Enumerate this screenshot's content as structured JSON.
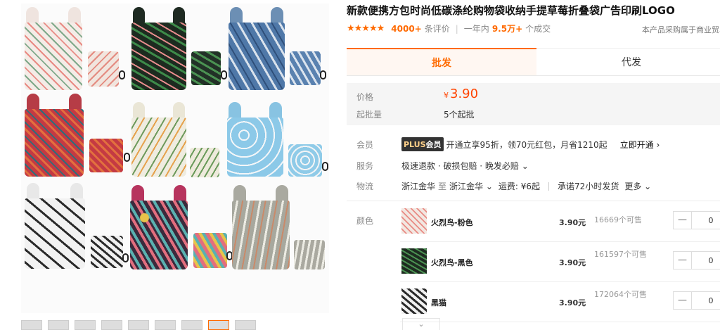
{
  "product": {
    "title": "新款便携方包时尚低碳涤纶购物袋收纳手提草莓折叠袋广告印刷LOGO",
    "stars": "★★★★★",
    "reviews_count": "4000+",
    "reviews_label": "条评价",
    "sales_period": "一年内",
    "sales_count": "9.5万+",
    "sales_label": "个成交",
    "purchase_note": "本产品采购属于商业贸易"
  },
  "tabs": [
    {
      "label": "批发",
      "active": true
    },
    {
      "label": "代发",
      "active": false
    }
  ],
  "price": {
    "label": "价格",
    "currency": "¥",
    "value": "3.90",
    "moq_label": "起批量",
    "moq_value": "5个起批"
  },
  "member": {
    "label": "会员",
    "badge_plus": "PLUS",
    "badge_text": "会员",
    "benefit": "开通立享95折，领70元红包，月省1210起",
    "cta": "立即开通 ›"
  },
  "service": {
    "label": "服务",
    "items": "极速退款 · 破损包赔 · 晚发必赔 ⌄"
  },
  "logistics": {
    "label": "物流",
    "from": "浙江金华",
    "to_label": "至",
    "to": "浙江金华 ⌄",
    "fee": "运费: ¥6起",
    "promise": "承诺72小时发货",
    "more": "更多 ⌄"
  },
  "colors": {
    "label": "颜色",
    "items": [
      {
        "name": "火烈鸟-粉色",
        "price": "3.90元",
        "stock": "16669个可售",
        "qty": "0"
      },
      {
        "name": "火烈鸟-黑色",
        "price": "3.90元",
        "stock": "161597个可售",
        "qty": "0"
      },
      {
        "name": "黑猫",
        "price": "3.90元",
        "stock": "172064个可售",
        "qty": "0"
      }
    ],
    "minus_symbol": "—",
    "more_arrow": "⌄"
  },
  "palette": {
    "accent": "#ff6a00",
    "price": "#ff4400"
  }
}
